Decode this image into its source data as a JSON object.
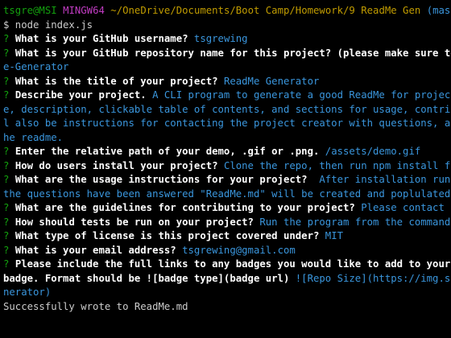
{
  "prompt": {
    "user": "tsgre",
    "host": "@MSI",
    "system": "MINGW64",
    "path": "~/OneDrive/Documents/Boot Camp/Homework/9 ReadMe Gen",
    "branch": "(master)"
  },
  "command": "$ node index.js",
  "lines": [
    {
      "parts": [
        {
          "t": "q",
          "v": "? "
        },
        {
          "t": "b",
          "v": "What is your GitHub username? "
        },
        {
          "t": "a",
          "v": "tsgrewing"
        }
      ]
    },
    {
      "parts": [
        {
          "t": "q",
          "v": "? "
        },
        {
          "t": "b",
          "v": "What is your GitHub repository name for this project? (please make sure to ent"
        }
      ]
    },
    {
      "parts": [
        {
          "t": "a",
          "v": "e-Generator"
        }
      ]
    },
    {
      "parts": [
        {
          "t": "q",
          "v": "? "
        },
        {
          "t": "b",
          "v": "What is the title of your project? "
        },
        {
          "t": "a",
          "v": "ReadMe Generator"
        }
      ]
    },
    {
      "parts": [
        {
          "t": "q",
          "v": "? "
        },
        {
          "t": "b",
          "v": "Describe your project. "
        },
        {
          "t": "a",
          "v": "A CLI program to generate a good ReadMe for projects. T"
        }
      ]
    },
    {
      "parts": [
        {
          "t": "a",
          "v": "e, description, clickable table of contents, and sections for usage, contributin"
        }
      ]
    },
    {
      "parts": [
        {
          "t": "a",
          "v": "l also be instructions for contacting the project creator with questions, and th"
        }
      ]
    },
    {
      "parts": [
        {
          "t": "a",
          "v": "he readme."
        }
      ]
    },
    {
      "parts": [
        {
          "t": "q",
          "v": "? "
        },
        {
          "t": "b",
          "v": "Enter the relative path of your demo, .gif or .png. "
        },
        {
          "t": "a",
          "v": "/assets/demo.gif"
        }
      ]
    },
    {
      "parts": [
        {
          "t": "q",
          "v": "? "
        },
        {
          "t": "b",
          "v": "How do users install your project? "
        },
        {
          "t": "a",
          "v": "Clone the repo, then run npm install from t"
        }
      ]
    },
    {
      "parts": [
        {
          "t": "q",
          "v": "? "
        },
        {
          "t": "b",
          "v": "What are the usage instructions for your project?  "
        },
        {
          "t": "a",
          "v": "After installation run inde"
        }
      ]
    },
    {
      "parts": [
        {
          "t": "a",
          "v": "the questions have been answered \"ReadMe.md\" will be created and poplulated with"
        }
      ]
    },
    {
      "parts": [
        {
          "t": "q",
          "v": "? "
        },
        {
          "t": "b",
          "v": "What are the guidelines for contributing to your project? "
        },
        {
          "t": "a",
          "v": "Please contact befor"
        }
      ]
    },
    {
      "parts": [
        {
          "t": "q",
          "v": "? "
        },
        {
          "t": "b",
          "v": "How should tests be run on your project? "
        },
        {
          "t": "a",
          "v": "Run the program from the command lin"
        }
      ]
    },
    {
      "parts": [
        {
          "t": "q",
          "v": "? "
        },
        {
          "t": "b",
          "v": "What type of license is this project covered under? "
        },
        {
          "t": "a",
          "v": "MIT"
        }
      ]
    },
    {
      "parts": [
        {
          "t": "q",
          "v": "? "
        },
        {
          "t": "b",
          "v": "What is your email address? "
        },
        {
          "t": "a",
          "v": "tsgrewing@gmail.com"
        }
      ]
    },
    {
      "parts": [
        {
          "t": "q",
          "v": "? "
        },
        {
          "t": "b",
          "v": "Please include the full links to any badges you would like to add to your read"
        }
      ]
    },
    {
      "parts": [
        {
          "t": "b",
          "v": "badge. Format should be ![badge type](badge url) "
        },
        {
          "t": "a",
          "v": "![Repo Size](https://img.shield"
        }
      ]
    },
    {
      "parts": [
        {
          "t": "a",
          "v": "nerator)"
        }
      ]
    },
    {
      "parts": [
        {
          "t": "out",
          "v": "Successfully wrote to ReadMe.md"
        }
      ]
    }
  ]
}
